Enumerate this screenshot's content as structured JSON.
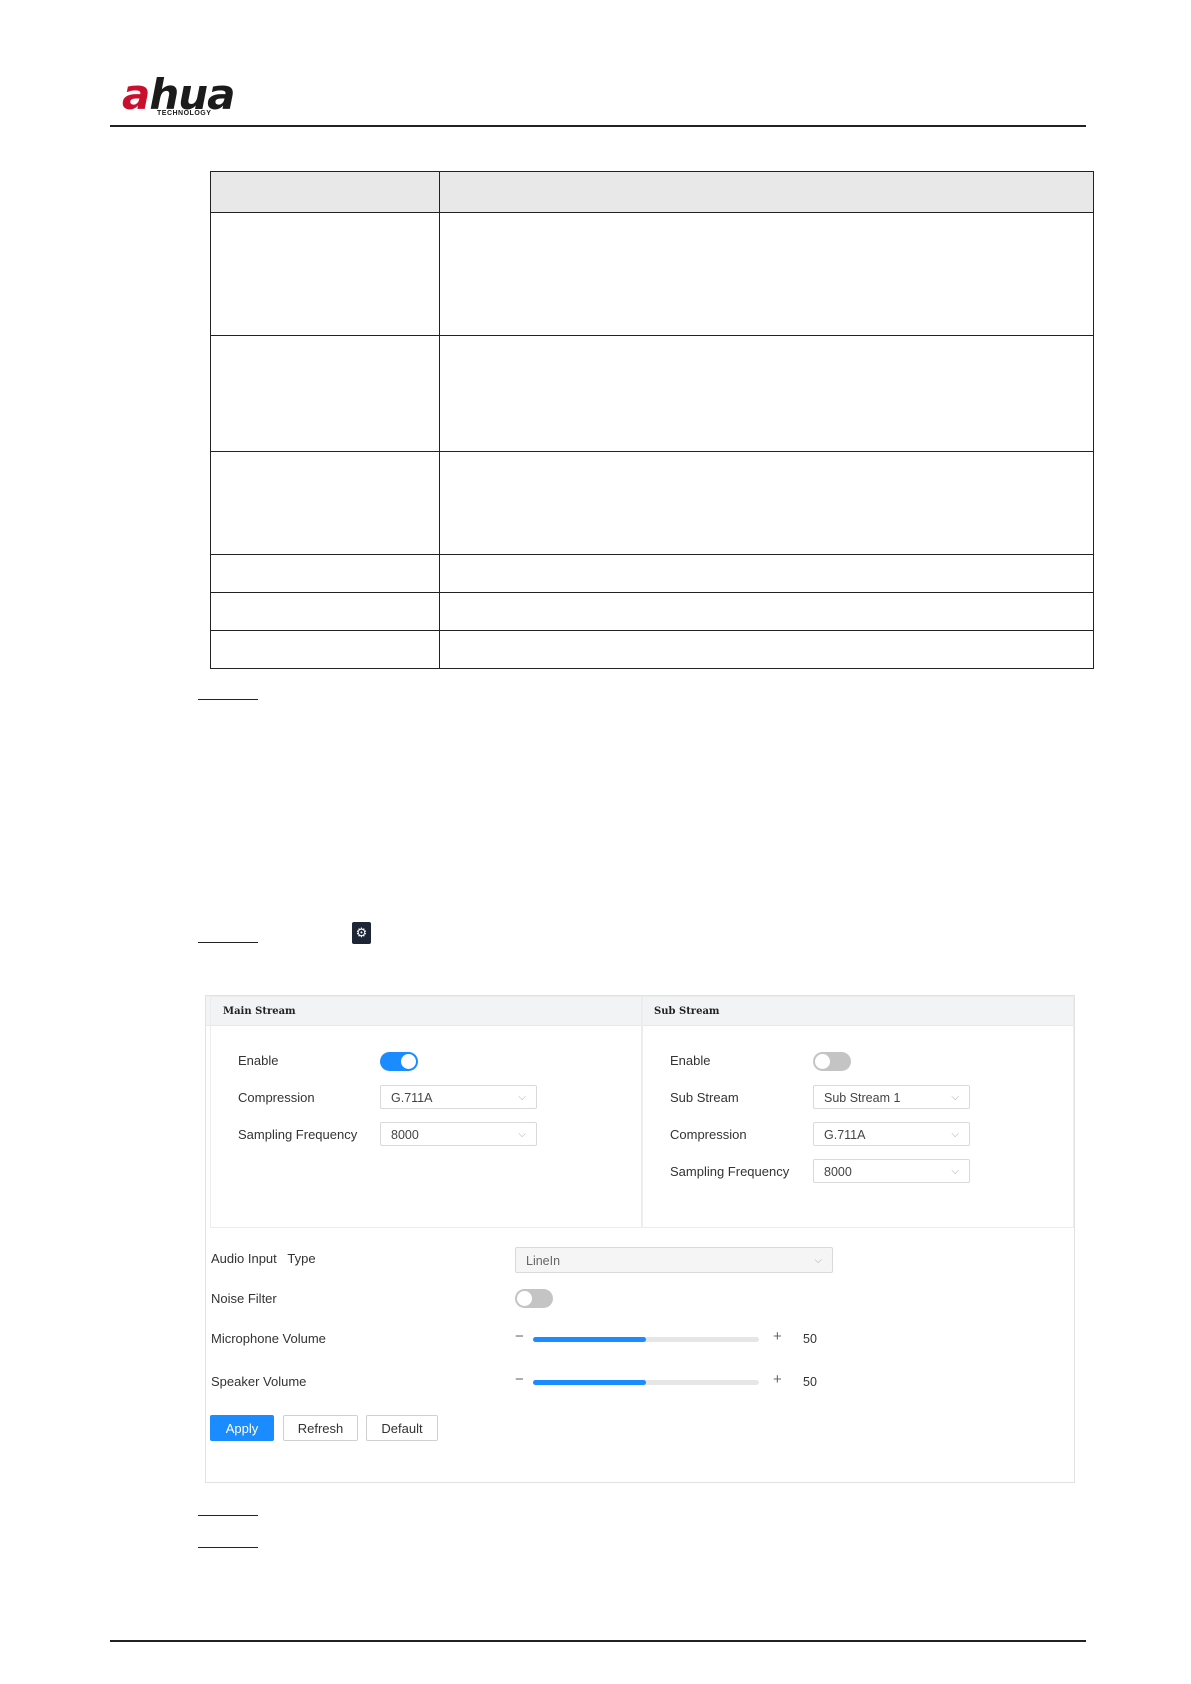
{
  "header": {
    "logo": {
      "a": "a",
      "rest": "hua",
      "sub": "TECHNOLOGY"
    }
  },
  "panel": {
    "main": {
      "title": "Main Stream",
      "enable_label": "Enable",
      "enable_on": true,
      "compression_label": "Compression",
      "compression_value": "G.711A",
      "sampling_label": "Sampling Frequency",
      "sampling_value": "8000"
    },
    "sub": {
      "title": "Sub Stream",
      "enable_label": "Enable",
      "enable_on": false,
      "substream_label": "Sub Stream",
      "substream_value": "Sub Stream 1",
      "compression_label": "Compression",
      "compression_value": "G.711A",
      "sampling_label": "Sampling Frequency",
      "sampling_value": "8000"
    },
    "audio_input_type_label": "Audio Input   Type",
    "audio_input_type_value": "LineIn",
    "noise_filter_label": "Noise Filter",
    "noise_filter_on": false,
    "mic_volume_label": "Microphone Volume",
    "mic_volume_value": "50",
    "speaker_volume_label": "Speaker Volume",
    "speaker_volume_value": "50",
    "minus": "−",
    "plus": "+",
    "chevron": "⌵",
    "buttons": {
      "apply": "Apply",
      "refresh": "Refresh",
      "default": "Default"
    }
  },
  "colors": {
    "accent": "#1a8cff",
    "logo_red": "#c8102e"
  },
  "icons": {
    "settings": "gear-icon"
  }
}
